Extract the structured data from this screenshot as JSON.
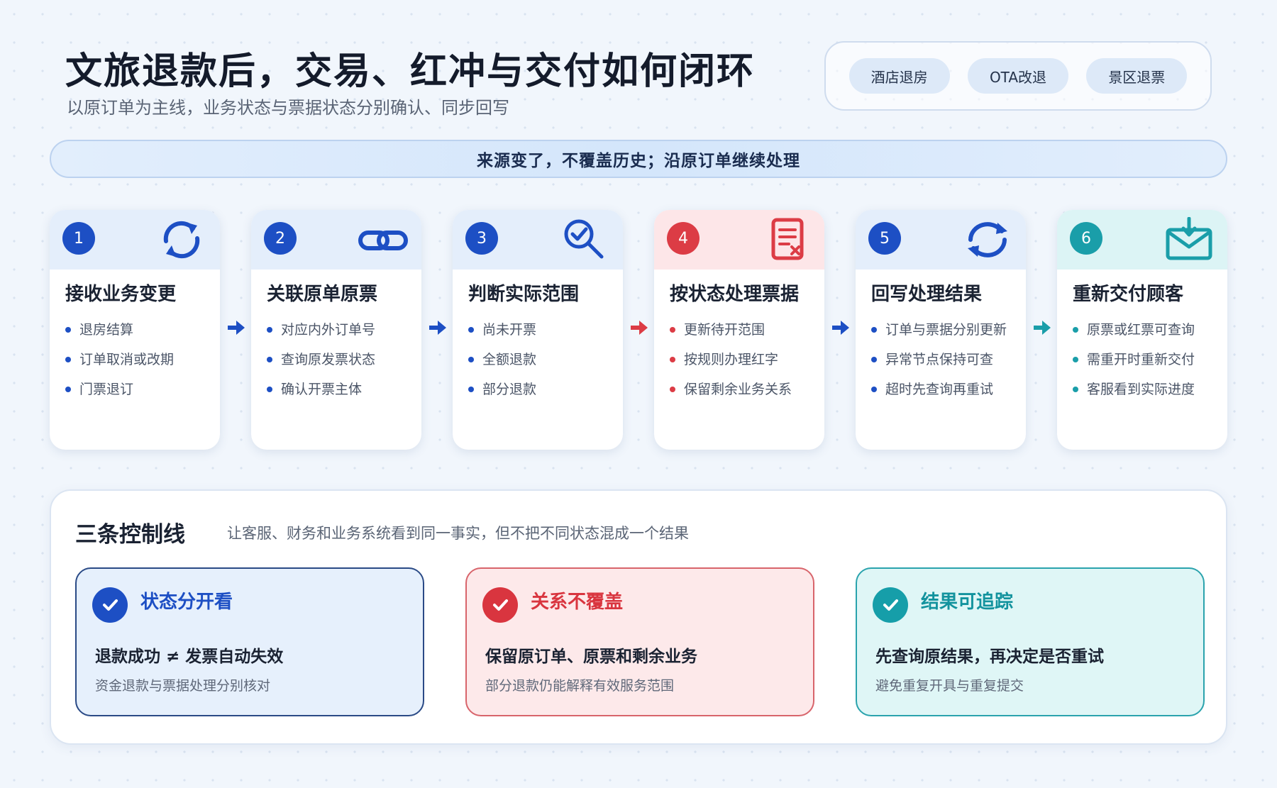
{
  "header": {
    "title": "文旅退款后，交易、红冲与交付如何闭环",
    "subtitle": "以原订单为主线，业务状态与票据状态分别确认、同步回写"
  },
  "scenarios": [
    "酒店退房",
    "OTA改退",
    "景区退票"
  ],
  "banner": "来源变了，不覆盖历史；沿原订单继续处理",
  "steps": [
    {
      "num": "1",
      "title": "接收业务变更",
      "icon": "sync-arrows-icon",
      "items": [
        "退房结算",
        "订单取消或改期",
        "门票退订"
      ]
    },
    {
      "num": "2",
      "title": "关联原单原票",
      "icon": "link-icon",
      "items": [
        "对应内外订单号",
        "查询原发票状态",
        "确认开票主体"
      ]
    },
    {
      "num": "3",
      "title": "判断实际范围",
      "icon": "magnifier-check-icon",
      "items": [
        "尚未开票",
        "全额退款",
        "部分退款"
      ]
    },
    {
      "num": "4",
      "title": "按状态处理票据",
      "icon": "invoice-cancel-icon",
      "items": [
        "更新待开范围",
        "按规则办理红字",
        "保留剩余业务关系"
      ]
    },
    {
      "num": "5",
      "title": "回写处理结果",
      "icon": "refresh-icon",
      "items": [
        "订单与票据分别更新",
        "异常节点保持可查",
        "超时先查询再重试"
      ]
    },
    {
      "num": "6",
      "title": "重新交付顾客",
      "icon": "mail-inbox-icon",
      "items": [
        "原票或红票可查询",
        "需重开时重新交付",
        "客服看到实际进度"
      ]
    }
  ],
  "controls": {
    "title": "三条控制线",
    "desc": "让客服、财务和业务系统看到同一事实，但不把不同状态混成一个结果",
    "items": [
      {
        "title": "状态分开看",
        "main": "退款成功 ≠ 发票自动失效",
        "sub": "资金退款与票据处理分别核对"
      },
      {
        "title": "关系不覆盖",
        "main": "保留原订单、原票和剩余业务",
        "sub": "部分退款仍能解释有效服务范围"
      },
      {
        "title": "结果可追踪",
        "main": "先查询原结果，再决定是否重试",
        "sub": "避免重复开具与重复提交"
      }
    ]
  },
  "colors": {
    "blue": "#1d4fc4",
    "red": "#dc3c45",
    "teal": "#1a9ea9"
  }
}
